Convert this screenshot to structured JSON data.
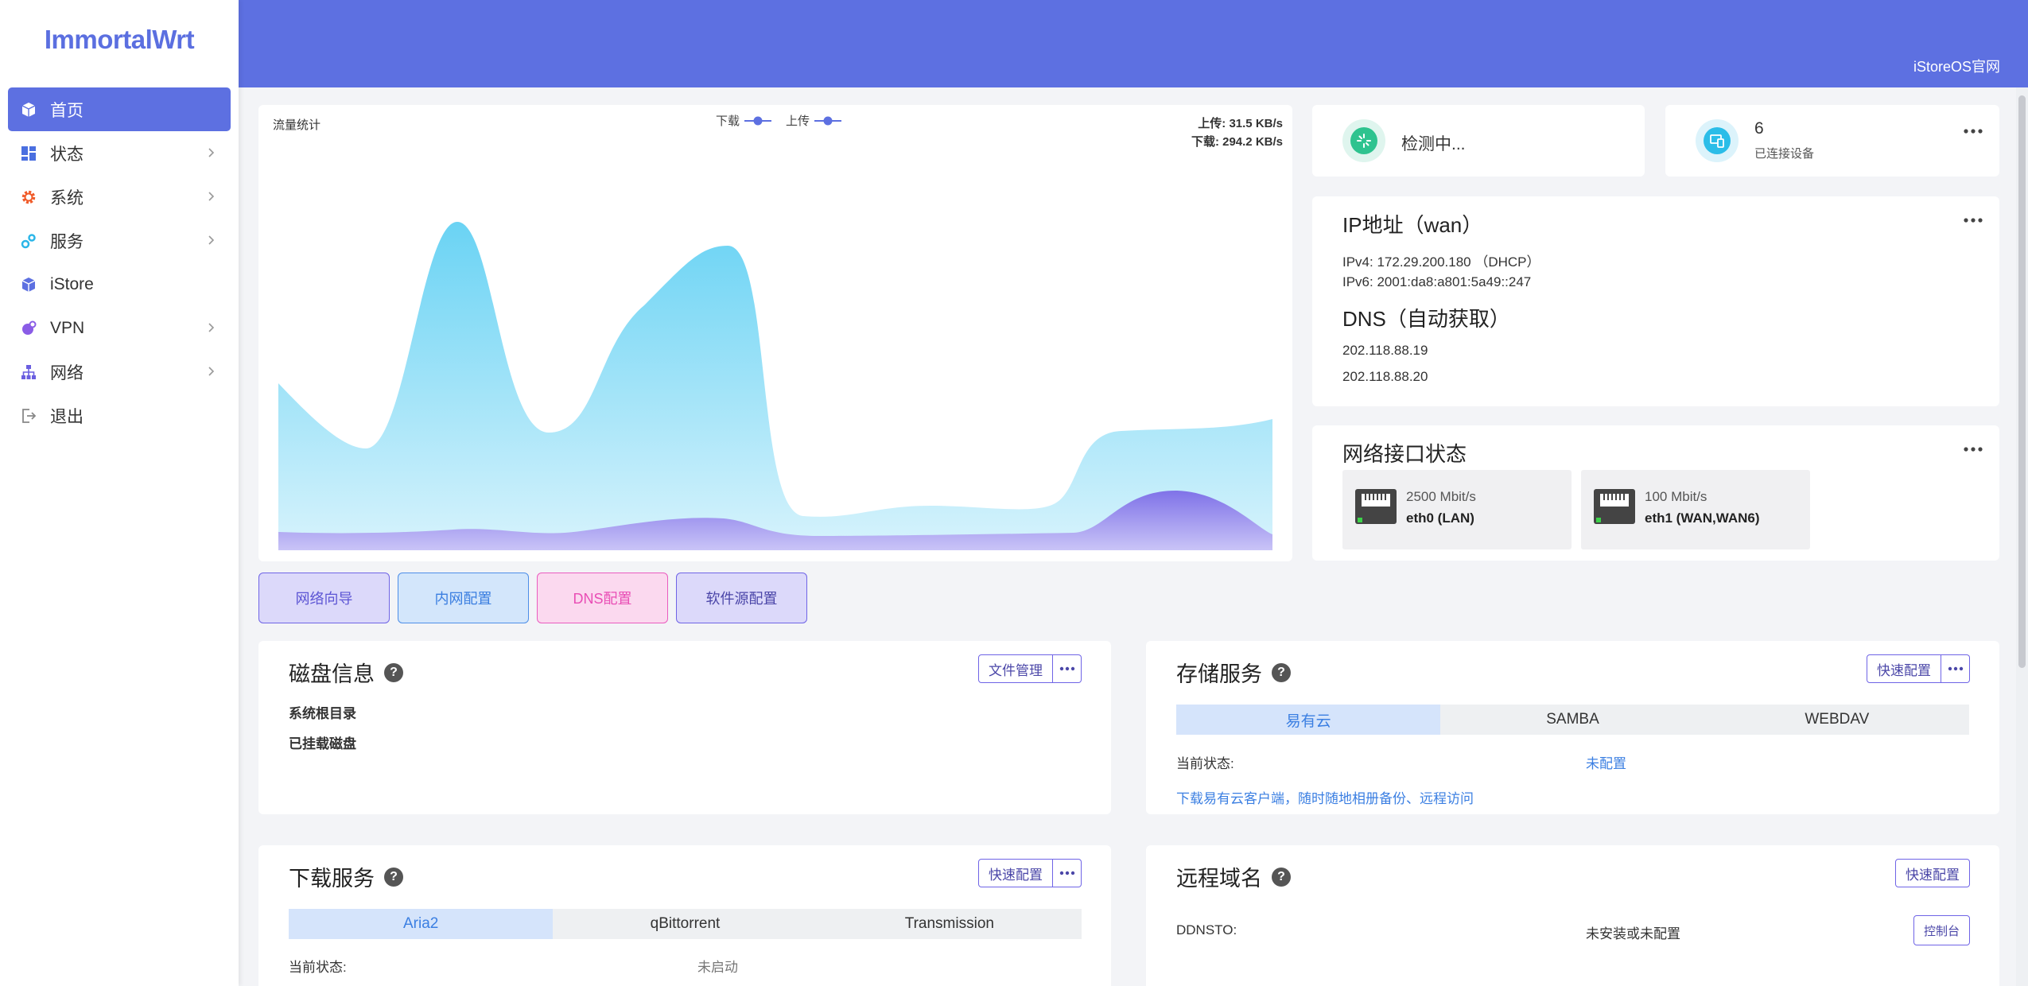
{
  "app": {
    "logo": "ImmortalWrt",
    "header_link": "iStoreOS官网"
  },
  "sidebar": {
    "items": [
      {
        "label": "首页",
        "icon": "cube-icon",
        "active": true
      },
      {
        "label": "状态",
        "icon": "dashboard-icon",
        "has_submenu": true
      },
      {
        "label": "系统",
        "icon": "gear-icon",
        "has_submenu": true
      },
      {
        "label": "服务",
        "icon": "services-icon",
        "has_submenu": true
      },
      {
        "label": "iStore",
        "icon": "cube-icon"
      },
      {
        "label": "VPN",
        "icon": "vpn-icon",
        "has_submenu": true
      },
      {
        "label": "网络",
        "icon": "network-icon",
        "has_submenu": true
      },
      {
        "label": "退出",
        "icon": "logout-icon"
      }
    ]
  },
  "traffic": {
    "title": "流量统计",
    "legend_download": "下载",
    "legend_upload": "上传",
    "upload_rate": "上传: 31.5 KB/s",
    "download_rate": "下载: 294.2 KB/s"
  },
  "quick_buttons": [
    "网络向导",
    "内网配置",
    "DNS配置",
    "软件源配置"
  ],
  "status": {
    "text": "检测中..."
  },
  "devices": {
    "count": "6",
    "label": "已连接设备"
  },
  "ip": {
    "title": "IP地址（wan）",
    "ipv4": "IPv4:   172.29.200.180  （DHCP）",
    "ipv6": "IPv6:   2001:da8:a801:5a49::247",
    "dns_title": "DNS（自动获取）",
    "dns": [
      "202.118.88.19",
      "202.118.88.20"
    ]
  },
  "interfaces": {
    "title": "网络接口状态",
    "ports": [
      {
        "speed": "2500 Mbit/s",
        "name": "eth0 (LAN)"
      },
      {
        "speed": "100 Mbit/s",
        "name": "eth1 (WAN,WAN6)"
      }
    ]
  },
  "disk": {
    "title": "磁盘信息",
    "button": "文件管理",
    "root": "系统根目录",
    "mounted": "已挂载磁盘"
  },
  "storage": {
    "title": "存储服务",
    "button": "快速配置",
    "tabs": [
      "易有云",
      "SAMBA",
      "WEBDAV"
    ],
    "status_label": "当前状态:",
    "status_value": "未配置",
    "link": "下载易有云客户端，随时随地相册备份、远程访问"
  },
  "download": {
    "title": "下载服务",
    "button": "快速配置",
    "tabs": [
      "Aria2",
      "qBittorrent",
      "Transmission"
    ],
    "status_label": "当前状态:",
    "status_value": "未启动"
  },
  "ddns": {
    "title": "远程域名",
    "button": "快速配置",
    "label": "DDNSTO:",
    "value": "未安装或未配置",
    "action": "控制台"
  },
  "colors": {
    "primary": "#5d70e1",
    "link": "#3b7fe2",
    "download_fill": "#6ad3f4",
    "upload_fill": "#7f72e8"
  }
}
